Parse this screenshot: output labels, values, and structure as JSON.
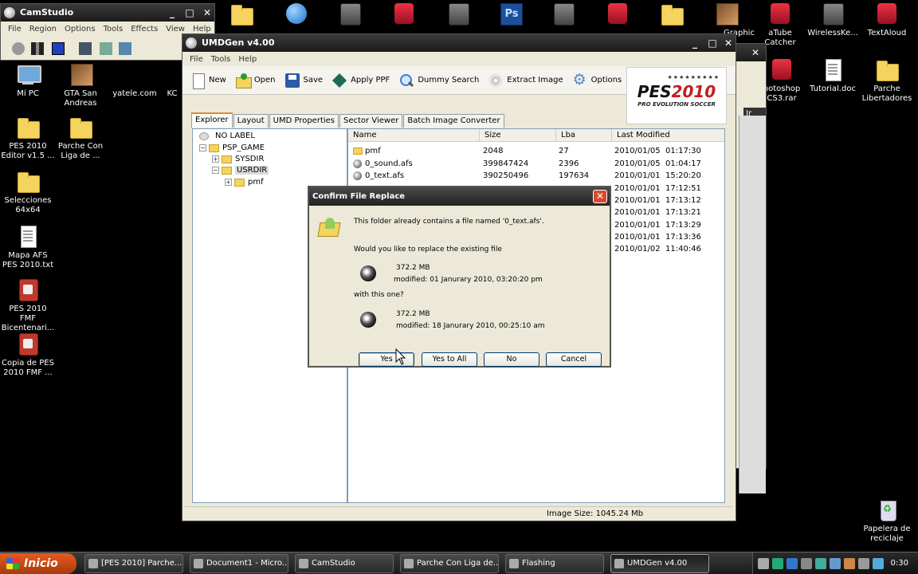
{
  "desktop": {
    "icons_left": [
      {
        "label": "Mi PC"
      },
      {
        "label": "PES 2010 Editor v1.5 ..."
      },
      {
        "label": "Selecciones 64x64"
      },
      {
        "label": "Mapa AFS PES 2010.txt"
      },
      {
        "label": "PES 2010 FMF Bicentenari..."
      },
      {
        "label": "Copia de PES 2010 FMF ..."
      }
    ],
    "icons_col2": [
      {
        "label": "GTA San Andreas"
      },
      {
        "label": "Parche Con Liga de ..."
      }
    ],
    "yatele": "yatele.com",
    "ko": "KC",
    "icons_right": [
      {
        "label": "aTube Catcher"
      },
      {
        "label": "WirelessKe..."
      },
      {
        "label": "TextAloud"
      },
      {
        "label": "notoshop CS3.rar"
      },
      {
        "label": "Tutorial.doc"
      },
      {
        "label": "Parche Libertadores"
      }
    ],
    "trash": "Papelera de reciclaje",
    "right_graphic_label": "Graphic",
    "ir_label": "Ir"
  },
  "camstudio": {
    "title": "CamStudio",
    "menu": [
      "File",
      "Region",
      "Options",
      "Tools",
      "Effects",
      "View",
      "Help"
    ]
  },
  "umdgen": {
    "title": "UMDGen v4.00",
    "menu": [
      "File",
      "Tools",
      "Help"
    ],
    "toolbar": {
      "new": "New",
      "open": "Open",
      "save": "Save",
      "apply_ppf": "Apply PPF",
      "dummy_search": "Dummy Search",
      "extract_image": "Extract Image",
      "options": "Options"
    },
    "logo": {
      "stars": "★★★★★★★★★",
      "pes": "PES",
      "year": "2010",
      "sub": "PRO EVOLUTION SOCCER"
    },
    "tabs": [
      "Explorer",
      "Layout",
      "UMD Properties",
      "Sector Viewer",
      "Batch Image Converter"
    ],
    "tree": {
      "root": "NO LABEL",
      "psp_game": "PSP_GAME",
      "sysdir": "SYSDIR",
      "usrdir": "USRDIR",
      "pmf": "pmf"
    },
    "columns": {
      "name": "Name",
      "size": "Size",
      "lba": "Lba",
      "modified": "Last Modified"
    },
    "files": [
      {
        "name": "pmf",
        "size": "2048",
        "lba": "27",
        "modified": "2010/01/05  01:17:30"
      },
      {
        "name": "0_sound.afs",
        "size": "399847424",
        "lba": "2396",
        "modified": "2010/01/05  01:04:17"
      },
      {
        "name": "0_text.afs",
        "size": "390250496",
        "lba": "197634",
        "modified": "2010/01/01  15:20:20"
      }
    ],
    "hidden_modified": [
      "2010/01/01  17:12:51",
      "2010/01/01  17:13:12",
      "2010/01/01  17:13:21",
      "2010/01/01  17:13:29",
      "2010/01/01  17:13:36",
      "2010/01/02  11:40:46"
    ],
    "status": "Image Size: 1045.24 Mb"
  },
  "dialog": {
    "title": "Confirm File Replace",
    "line1": "This folder already contains a file named '0_text.afs'.",
    "line2": "Would you like to replace the existing file",
    "existing_size": "372.2 MB",
    "existing_modified": "modified: 01 Janurary 2010, 03:20:20 pm",
    "with_this": "with this one?",
    "new_size": "372.2 MB",
    "new_modified": "modified: 18 Janurary 2010, 00:25:10 am",
    "buttons": {
      "yes": "Yes",
      "yes_to_all": "Yes to All",
      "no": "No",
      "cancel": "Cancel"
    }
  },
  "taskbar": {
    "start": "Inicio",
    "tasks": [
      "[PES 2010] Parche...",
      "Document1 - Micro...",
      "CamStudio",
      "Parche Con Liga de...",
      "Flashing",
      "UMDGen v4.00"
    ],
    "clock": "0:30"
  }
}
